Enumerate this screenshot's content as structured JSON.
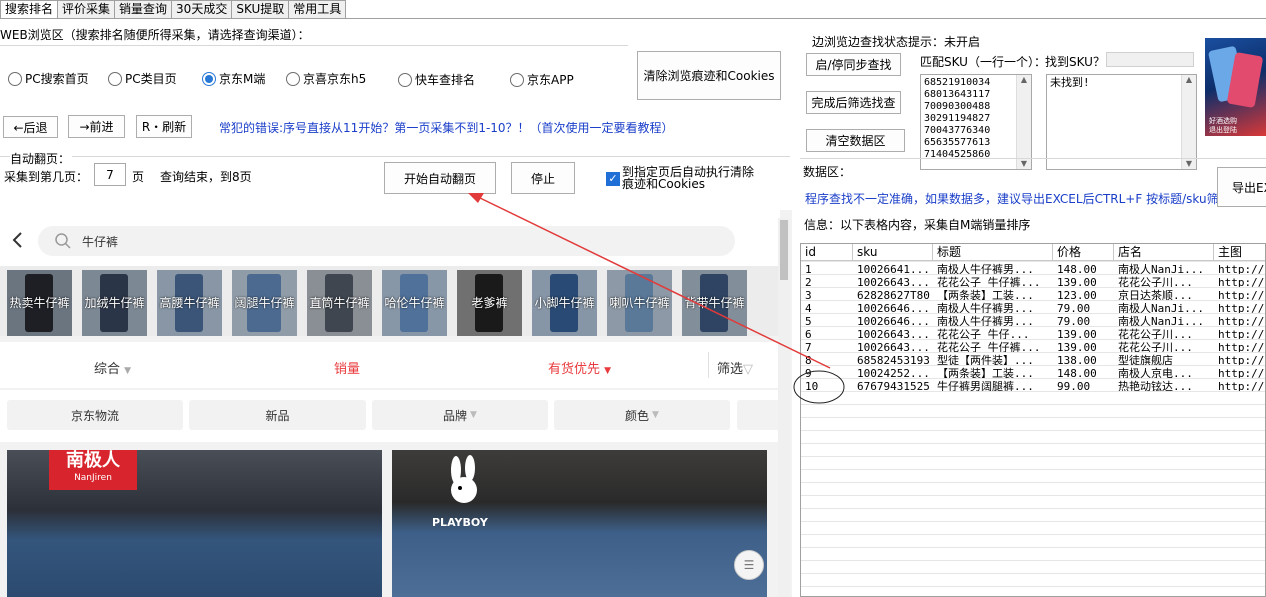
{
  "tabs": [
    "搜索排名",
    "评价采集",
    "销量查询",
    "30天成交",
    "SKU提取",
    "常用工具"
  ],
  "web_section_label": "WEB浏览区（搜索排名随便所得采集，请选择查询渠道）：",
  "channels": [
    {
      "label": "PC搜索首页",
      "selected": false
    },
    {
      "label": "PC类目页",
      "selected": false
    },
    {
      "label": "京东M端",
      "selected": true
    },
    {
      "label": "京喜京东h5",
      "selected": false
    },
    {
      "label": "快车查排名",
      "selected": false
    },
    {
      "label": "京东APP",
      "selected": false
    }
  ],
  "clear_cookies_button": "清除浏览痕迹和Cookies",
  "nav": {
    "back": "←后退",
    "forward": "→前进",
    "refresh": "R・刷新"
  },
  "tip": "常犯的错误:序号直接从11开始？第一页采集不到1-10？！（首次使用一定要看教程）",
  "auto_page": {
    "label": "自动翻页：",
    "collect_to_label": "采集到第几页：",
    "page_value": "7",
    "page_unit": "页",
    "status": "查询结束，到8页",
    "start_button": "开始自动翻页",
    "stop_button": "停止",
    "auto_clear_label_1": "到指定页后自动执行清除",
    "auto_clear_label_2": "痕迹和Cookies",
    "auto_clear_checked": true
  },
  "browser": {
    "search_text": "牛仔裤",
    "categories": [
      "热卖牛仔裤",
      "加绒牛仔裤",
      "高腰牛仔裤",
      "阔腿牛仔裤",
      "直筒牛仔裤",
      "哈伦牛仔裤",
      "老爹裤",
      "小脚牛仔裤",
      "喇叭牛仔裤",
      "背带牛仔裤"
    ],
    "sort": [
      "综合",
      "销量",
      "有货优先",
      "筛选"
    ],
    "filters": [
      "京东物流",
      "新品",
      "品牌",
      "颜色"
    ],
    "brand1": "南极人",
    "brand1_sub": "NanJiren",
    "brand2": "PLAYBOY"
  },
  "right": {
    "status_label": "边浏览边查找状态提示：未开启",
    "sync_button": "启/停同步查找",
    "filter_button": "完成后筛选找查",
    "clear_button": "清空数据区",
    "match_sku_label": "匹配SKU（一行一个）：",
    "found_sku_label": "找到SKU？",
    "sku_list": [
      "68521910034",
      "68013643117",
      "70090300488",
      "30291194827",
      "70043776340",
      "65635577613",
      "71404525860"
    ],
    "found_result": "未找到!",
    "data_area_label": "数据区：",
    "data_tip": "程序查找不一定准确，如果数据多，建议导出EXCEL后CTRL+F 按标题/sku筛选.",
    "export_button": "导出EX",
    "info_label": "信息：以下表格内容，采集自M端销量排序",
    "ad_text_1": "好酒选购",
    "ad_text_2": "退出登陆"
  },
  "table": {
    "headers": [
      "id",
      "sku",
      "标题",
      "价格",
      "店名",
      "主图"
    ],
    "rows": [
      [
        "1",
        "10026641...",
        "南极人牛仔裤男...",
        "148.00",
        "南极人NanJi...",
        "http://i"
      ],
      [
        "2",
        "10026643...",
        "花花公子 牛仔裤...",
        "139.00",
        "花花公子川...",
        "http://i"
      ],
      [
        "3",
        "62828627T80",
        "【两条装】工装...",
        "123.00",
        "京日达茶顺...",
        "http://i"
      ],
      [
        "4",
        "10026646...",
        "南极人牛仔裤男...",
        "79.00",
        "南极人NanJi...",
        "http://i"
      ],
      [
        "5",
        "10026646...",
        "南极人牛仔裤男...",
        "79.00",
        "南极人NanJi...",
        "http://i"
      ],
      [
        "6",
        "10026643...",
        "花花公子 牛仔...",
        "139.00",
        "花花公子川...",
        "http://i"
      ],
      [
        "7",
        "10026643...",
        "花花公子 牛仔裤...",
        "139.00",
        "花花公子川...",
        "http://i"
      ],
      [
        "8",
        "68582453193",
        "型徒【两件装】...",
        "138.00",
        "型徒旗舰店",
        "http://i"
      ],
      [
        "9",
        "10024252...",
        "【两条装】工装...",
        "148.00",
        "南极人京电...",
        "http://i"
      ],
      [
        "10",
        "67679431525",
        "牛仔裤男阔腿裤...",
        "99.00",
        "热艳动铉达...",
        "http://i"
      ]
    ]
  },
  "colors": {
    "accent": "#2878d7",
    "tip_blue": "#1a3ec9",
    "sort_red": "#e93b3d",
    "annotation_red": "#e23a3a"
  }
}
